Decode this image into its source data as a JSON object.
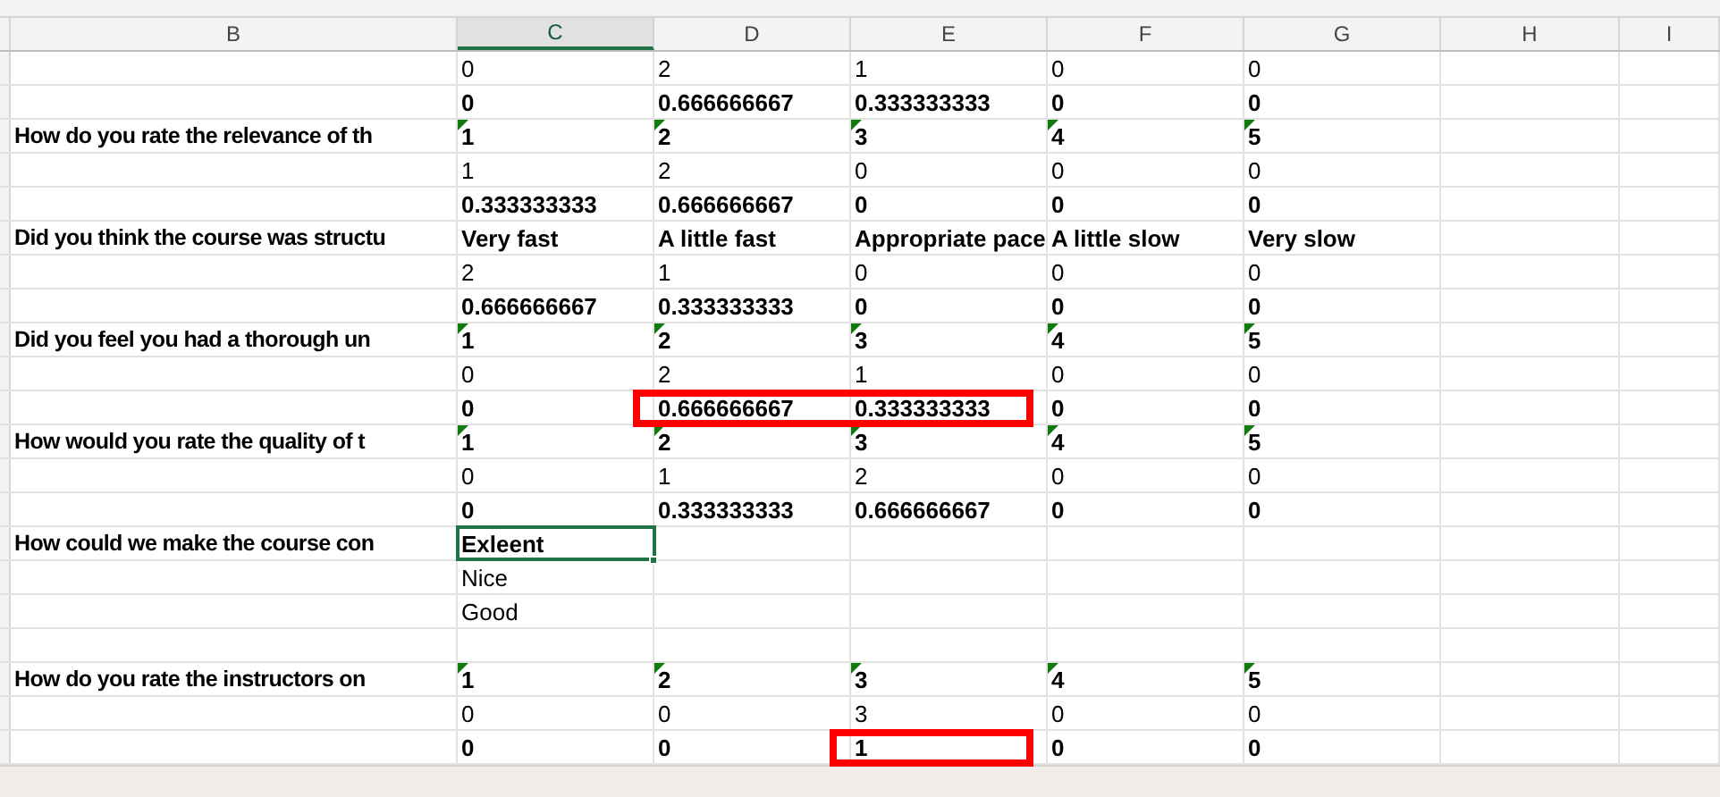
{
  "columns": [
    {
      "label": "B",
      "selected": false
    },
    {
      "label": "C",
      "selected": true
    },
    {
      "label": "D",
      "selected": false
    },
    {
      "label": "E",
      "selected": false
    },
    {
      "label": "F",
      "selected": false
    },
    {
      "label": "G",
      "selected": false
    },
    {
      "label": "H",
      "selected": false
    },
    {
      "label": "I",
      "selected": false
    }
  ],
  "rows": [
    {
      "cells": [
        {
          "text": "0",
          "bold": false
        },
        {
          "text": "2",
          "bold": false
        },
        {
          "text": "1",
          "bold": false
        },
        {
          "text": "0",
          "bold": false
        },
        {
          "text": "0",
          "bold": false
        }
      ]
    },
    {
      "cells": [
        {
          "text": "0",
          "bold": true
        },
        {
          "text": "0.666666667",
          "bold": true
        },
        {
          "text": "0.333333333",
          "bold": true
        },
        {
          "text": "0",
          "bold": true
        },
        {
          "text": "0",
          "bold": true
        }
      ]
    },
    {
      "question": "How do you rate the relevance of th",
      "cells": [
        {
          "text": "1",
          "bold": true,
          "flagged": true
        },
        {
          "text": "2",
          "bold": true,
          "flagged": true
        },
        {
          "text": "3",
          "bold": true,
          "flagged": true
        },
        {
          "text": "4",
          "bold": true,
          "flagged": true
        },
        {
          "text": "5",
          "bold": true,
          "flagged": true
        }
      ]
    },
    {
      "cells": [
        {
          "text": "1",
          "bold": false
        },
        {
          "text": "2",
          "bold": false
        },
        {
          "text": "0",
          "bold": false
        },
        {
          "text": "0",
          "bold": false
        },
        {
          "text": "0",
          "bold": false
        }
      ]
    },
    {
      "cells": [
        {
          "text": "0.333333333",
          "bold": true
        },
        {
          "text": "0.666666667",
          "bold": true
        },
        {
          "text": "0",
          "bold": true
        },
        {
          "text": "0",
          "bold": true
        },
        {
          "text": "0",
          "bold": true
        }
      ]
    },
    {
      "question": "Did you think the course was structu",
      "cells": [
        {
          "text": "Very fast",
          "bold": true
        },
        {
          "text": "A little fast",
          "bold": true
        },
        {
          "text": "Appropriate pace",
          "bold": true
        },
        {
          "text": "A little slow",
          "bold": true
        },
        {
          "text": "Very slow",
          "bold": true
        }
      ]
    },
    {
      "cells": [
        {
          "text": "2",
          "bold": false
        },
        {
          "text": "1",
          "bold": false
        },
        {
          "text": "0",
          "bold": false
        },
        {
          "text": "0",
          "bold": false
        },
        {
          "text": "0",
          "bold": false
        }
      ]
    },
    {
      "cells": [
        {
          "text": "0.666666667",
          "bold": true
        },
        {
          "text": "0.333333333",
          "bold": true
        },
        {
          "text": "0",
          "bold": true
        },
        {
          "text": "0",
          "bold": true
        },
        {
          "text": "0",
          "bold": true
        }
      ]
    },
    {
      "question": "Did you feel you had a thorough un",
      "cells": [
        {
          "text": "1",
          "bold": true,
          "flagged": true
        },
        {
          "text": "2",
          "bold": true,
          "flagged": true
        },
        {
          "text": "3",
          "bold": true,
          "flagged": true
        },
        {
          "text": "4",
          "bold": true,
          "flagged": true
        },
        {
          "text": "5",
          "bold": true,
          "flagged": true
        }
      ]
    },
    {
      "cells": [
        {
          "text": "0",
          "bold": false
        },
        {
          "text": "2",
          "bold": false
        },
        {
          "text": "1",
          "bold": false
        },
        {
          "text": "0",
          "bold": false
        },
        {
          "text": "0",
          "bold": false
        }
      ]
    },
    {
      "cells": [
        {
          "text": "0",
          "bold": true
        },
        {
          "text": "0.666666667",
          "bold": true,
          "marked": true
        },
        {
          "text": "0.333333333",
          "bold": true,
          "marked": true
        },
        {
          "text": "0",
          "bold": true
        },
        {
          "text": "0",
          "bold": true
        }
      ]
    },
    {
      "question": "How would you rate the quality of t",
      "cells": [
        {
          "text": "1",
          "bold": true,
          "flagged": true
        },
        {
          "text": "2",
          "bold": true,
          "flagged": true
        },
        {
          "text": "3",
          "bold": true,
          "flagged": true
        },
        {
          "text": "4",
          "bold": true,
          "flagged": true
        },
        {
          "text": "5",
          "bold": true,
          "flagged": true
        }
      ]
    },
    {
      "cells": [
        {
          "text": "0",
          "bold": false
        },
        {
          "text": "1",
          "bold": false
        },
        {
          "text": "2",
          "bold": false
        },
        {
          "text": "0",
          "bold": false
        },
        {
          "text": "0",
          "bold": false
        }
      ]
    },
    {
      "cells": [
        {
          "text": "0",
          "bold": true
        },
        {
          "text": "0.333333333",
          "bold": true
        },
        {
          "text": "0.666666667",
          "bold": true
        },
        {
          "text": "0",
          "bold": true
        },
        {
          "text": "0",
          "bold": true
        }
      ]
    },
    {
      "question": "How could we make the course con",
      "cells": [
        {
          "text": "Exleent",
          "bold": true,
          "selected": true
        }
      ]
    },
    {
      "cells": [
        {
          "text": "Nice",
          "bold": false,
          "selected": false
        }
      ]
    },
    {
      "cells": [
        {
          "text": "Good",
          "bold": false,
          "selected": false
        }
      ]
    },
    {
      "cells": []
    },
    {
      "question": "How do you rate the instructors on",
      "cells": [
        {
          "text": "1",
          "bold": true,
          "flagged": true
        },
        {
          "text": "2",
          "bold": true,
          "flagged": true
        },
        {
          "text": "3",
          "bold": true,
          "flagged": true
        },
        {
          "text": "4",
          "bold": true,
          "flagged": true
        },
        {
          "text": "5",
          "bold": true,
          "flagged": true
        }
      ]
    },
    {
      "cells": [
        {
          "text": "0",
          "bold": false
        },
        {
          "text": "0",
          "bold": false
        },
        {
          "text": "3",
          "bold": false
        },
        {
          "text": "0",
          "bold": false
        },
        {
          "text": "0",
          "bold": false
        }
      ]
    },
    {
      "cells": [
        {
          "text": "0",
          "bold": true
        },
        {
          "text": "0",
          "bold": true
        },
        {
          "text": "1",
          "bold": true,
          "marked": true
        },
        {
          "text": "0",
          "bold": true
        },
        {
          "text": "0",
          "bold": true
        }
      ]
    }
  ]
}
